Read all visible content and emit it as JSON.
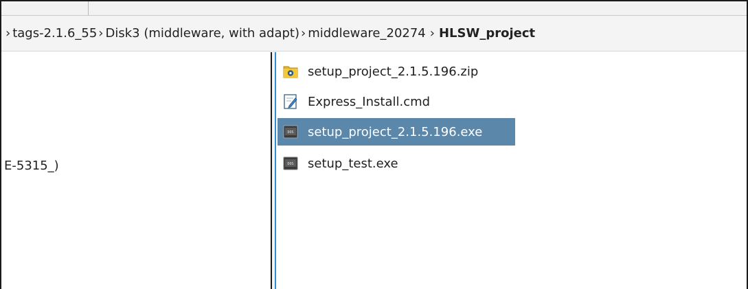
{
  "breadcrumb": {
    "items": [
      {
        "label": "tags-2.1.6_55"
      },
      {
        "label": "Disk3 (middleware, with adapt)"
      },
      {
        "label": "middleware_20274"
      },
      {
        "label": "HLSW_project"
      }
    ]
  },
  "left_pane": {
    "visible_item": "E-5315_)"
  },
  "files": [
    {
      "name": "setup_project_2.1.5.196.zip",
      "icon": "zip-archive-icon",
      "selected": false
    },
    {
      "name": "Express_Install.cmd",
      "icon": "script-file-icon",
      "selected": false
    },
    {
      "name": "setup_project_2.1.5.196.exe",
      "icon": "dos-executable-icon",
      "selected": true
    },
    {
      "name": "setup_test.exe",
      "icon": "dos-executable-icon",
      "selected": false
    }
  ],
  "colors": {
    "selection": "#5b87ab",
    "focus_border": "#2e8cd2"
  }
}
